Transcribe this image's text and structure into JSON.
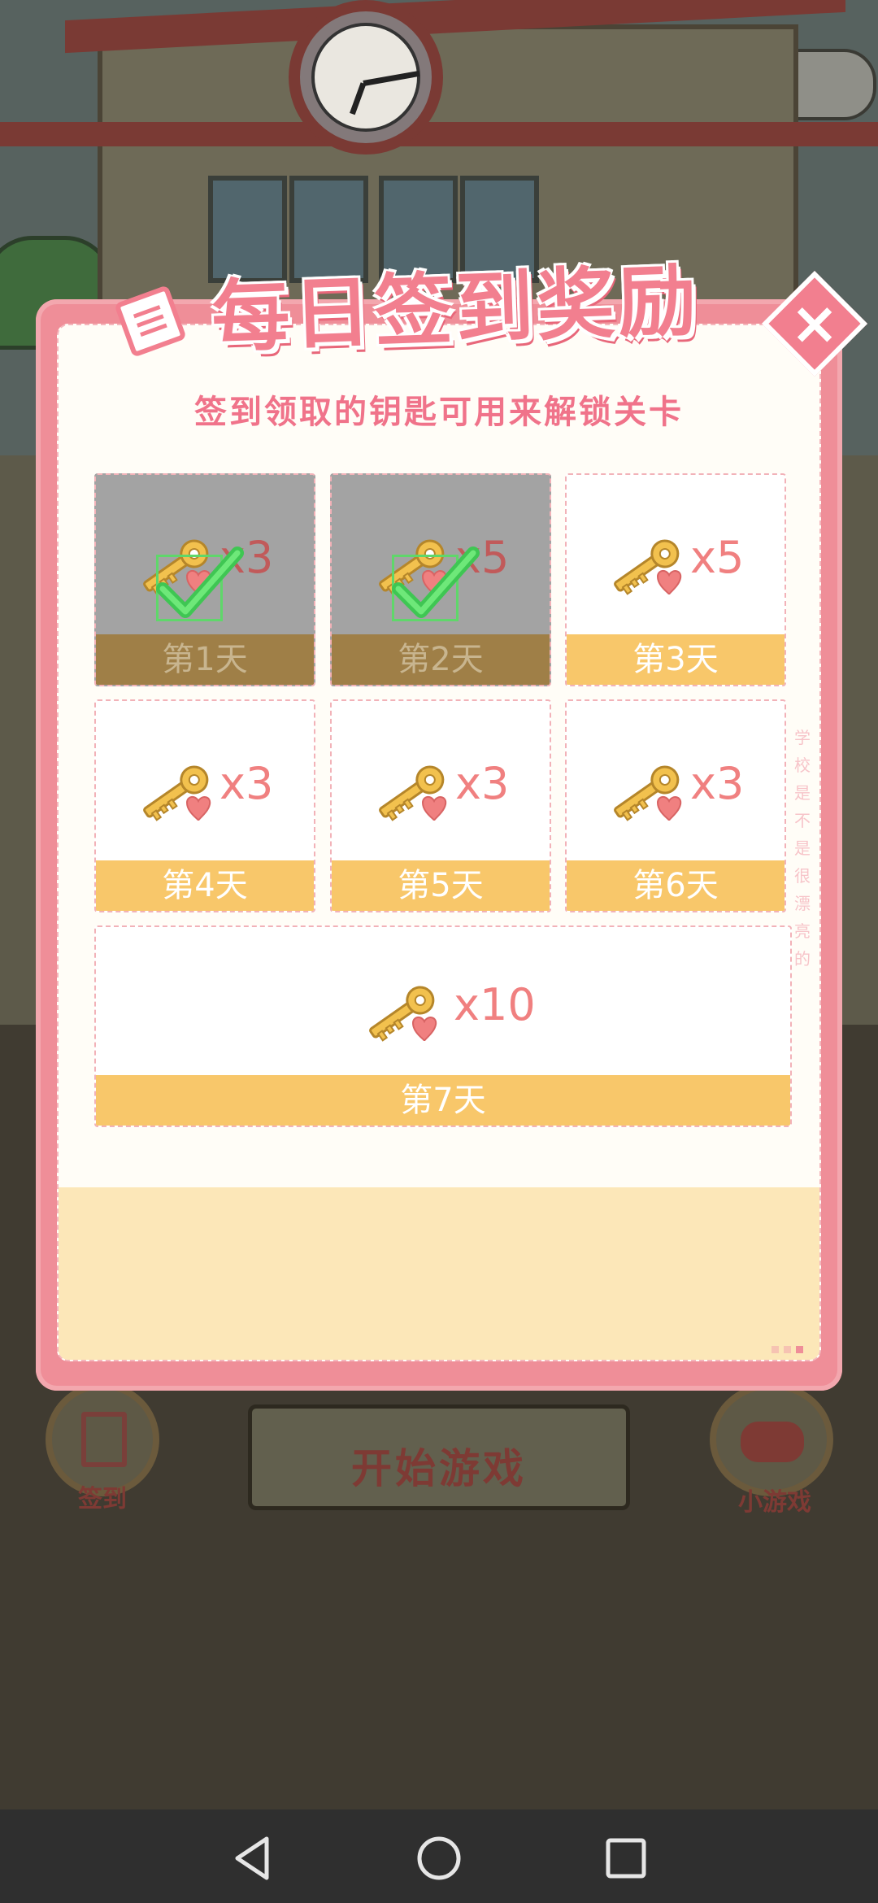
{
  "dialog": {
    "title": "每日签到奖励",
    "subtitle": "签到领取的钥匙可用来解锁关卡",
    "close_label": "×",
    "side_text": "学校是不是很漂亮的"
  },
  "days": [
    {
      "label": "第1天",
      "amount": "x3",
      "claimed": true
    },
    {
      "label": "第2天",
      "amount": "x5",
      "claimed": true
    },
    {
      "label": "第3天",
      "amount": "x5",
      "claimed": false
    },
    {
      "label": "第4天",
      "amount": "x3",
      "claimed": false
    },
    {
      "label": "第5天",
      "amount": "x3",
      "claimed": false
    },
    {
      "label": "第6天",
      "amount": "x3",
      "claimed": false
    },
    {
      "label": "第7天",
      "amount": "x10",
      "claimed": false
    }
  ],
  "background_ui": {
    "sign_label": "签到",
    "start_label": "开始游戏",
    "minigame_label": "小游戏"
  },
  "colors": {
    "accent_pink": "#f27f8f",
    "card_footer": "#f8c76a",
    "claimed_footer": "#9f7f47",
    "check_green": "#5fd76a"
  },
  "icons": {
    "reward": "key-heart-icon",
    "claimed": "checkmark-icon",
    "nav_back": "back-triangle-icon",
    "nav_home": "home-circle-icon",
    "nav_recent": "recent-square-icon"
  }
}
